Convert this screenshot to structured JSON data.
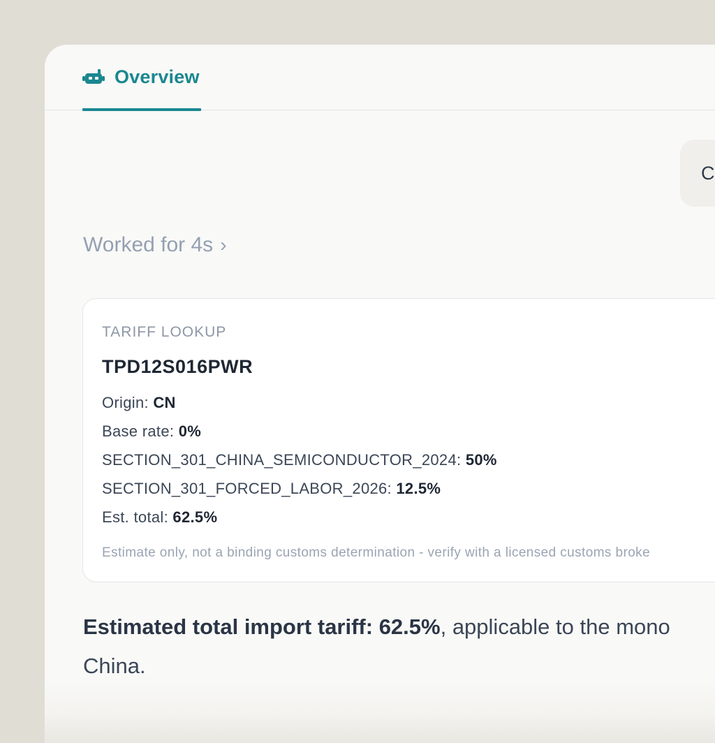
{
  "tab": {
    "label": "Overview",
    "icon": "robot-icon",
    "accent_color": "#1a8790"
  },
  "user_message": {
    "text": "C"
  },
  "status": {
    "worked_label": "Worked for 4s",
    "chevron": "›"
  },
  "tool_card": {
    "kicker": "TARIFF LOOKUP",
    "title": "TPD12S016PWR",
    "rows": [
      {
        "label": "Origin: ",
        "value": "CN"
      },
      {
        "label": "Base rate: ",
        "value": "0%"
      },
      {
        "label": "SECTION_301_CHINA_SEMICONDUCTOR_2024: ",
        "value": "50%"
      },
      {
        "label": "SECTION_301_FORCED_LABOR_2026: ",
        "value": "12.5%"
      },
      {
        "label": "Est. total: ",
        "value": "62.5%"
      }
    ],
    "disclaimer": "Estimate only, not a binding customs determination - verify with a licensed customs broke"
  },
  "answer": {
    "bold": "Estimated total import tariff: 62.5%",
    "rest_line1": ", applicable to the mono",
    "rest_line2": "China."
  }
}
